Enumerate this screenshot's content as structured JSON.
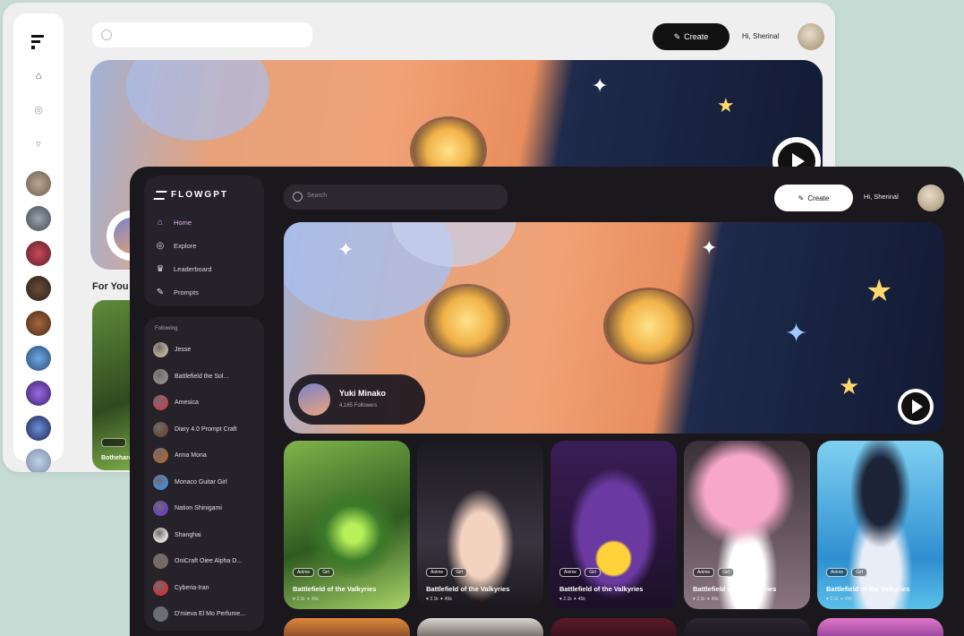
{
  "light_window": {
    "search": {
      "placeholder": ""
    },
    "create_label": "Create",
    "greeting": "Hi, Sherinal",
    "section_title": "For You",
    "card_title": "Bothehard",
    "colors": {
      "background": "#efefef",
      "accent": "#111111"
    }
  },
  "dark_window": {
    "brand": "FLOWGPT",
    "nav": [
      {
        "label": "Home",
        "icon": "home-icon",
        "active": true
      },
      {
        "label": "Explore",
        "icon": "compass-icon",
        "active": false
      },
      {
        "label": "Leaderboard",
        "icon": "trophy-icon",
        "active": false
      },
      {
        "label": "Prompts",
        "icon": "feather-icon",
        "active": false
      }
    ],
    "following_header": "Following",
    "following": [
      {
        "label": "Jesse",
        "color": "#b9a992"
      },
      {
        "label": "Battlefield the Sol...",
        "color": "#8f8a86"
      },
      {
        "label": "Amesica",
        "color": "#b74a55"
      },
      {
        "label": "Diary 4.0 Prompt Craft",
        "color": "#6a4d3a"
      },
      {
        "label": "Anna Mona",
        "color": "#a3673f"
      },
      {
        "label": "Monaco Guitar Girl",
        "color": "#4f88c9"
      },
      {
        "label": "Nation Shinigami",
        "color": "#6c43b6"
      },
      {
        "label": "Shanghai",
        "color": "#d9d9d9"
      },
      {
        "label": "OniCraft Oiee Alpha D...",
        "color": "#7a6b5e"
      },
      {
        "label": "Cyberia-Iran",
        "color": "#c23b3b"
      },
      {
        "label": "D'mieva El Mo Perfume...",
        "color": "#6b6f78"
      }
    ],
    "search_placeholder": "Search",
    "create_label": "Create",
    "greeting": "Hi, Sherinal",
    "hero": {
      "name": "Yuki Minako",
      "subtitle": "4,165 Followers"
    },
    "cards": [
      {
        "tags": [
          "Anime",
          "Girl"
        ],
        "title": "Battlefield of the Valkyries",
        "meta": "♥ 2.1k  ✦ 45k",
        "theme": "forest"
      },
      {
        "tags": [
          "Anime",
          "Girl"
        ],
        "title": "Battlefield of the Valkyries",
        "meta": "♥ 2.1k  ✦ 45k",
        "theme": "dark-hair"
      },
      {
        "tags": [
          "Anime",
          "Girl"
        ],
        "title": "Battlefield of the Valkyries",
        "meta": "♥ 2.1k  ✦ 45k",
        "theme": "violet"
      },
      {
        "tags": [
          "Anime",
          "Girl"
        ],
        "title": "Battlefield of the Valkyries",
        "meta": "♥ 2.1k  ✦ 45k",
        "theme": "pink"
      },
      {
        "tags": [
          "Anime",
          "Girl"
        ],
        "title": "Battlefield of the Valkyries",
        "meta": "♥ 2.1k  ✦ 45k",
        "theme": "sky"
      }
    ],
    "colors": {
      "background": "#1a181d",
      "panel": "#25222a",
      "active": "#c9a1ff"
    }
  }
}
